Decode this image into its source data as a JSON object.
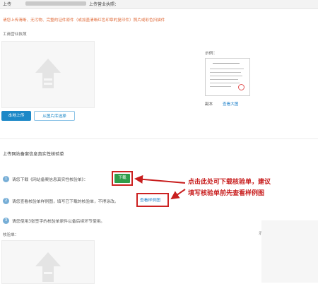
{
  "header": {
    "label_left": "上传",
    "label_right": "上传营业执照："
  },
  "requirements": "请您上传清晰、无污物、完整的证件原件（或加盖清晰红色印章的复印件）照片或彩色扫描件",
  "business_license": {
    "label": "工商营业执照",
    "sample_label": "示例：",
    "copy_label": "副本",
    "view_large": "查看大图",
    "local_upload_button": "本地上传",
    "library_button": "从图片库选择"
  },
  "verification": {
    "section_title": "上传网站备案信息真实性核验单",
    "steps": [
      {
        "num": "1",
        "text": "请您下载《网站备案信息真实性核验单》："
      },
      {
        "num": "2",
        "text": "请您查看核验单样例图，填写已下载的核验单，不得涂改。"
      },
      {
        "num": "3",
        "text": "请您使用3张签字的核验单原件以备后续环节使用。"
      }
    ],
    "download_button": "下载",
    "view_sample_link": "查看样例图",
    "bottom_label": "核验单：",
    "right_fragment": "示"
  },
  "annotation": {
    "line1": "点击此处可下载核验单，建议",
    "line2": "填写核验单前先查看样例图",
    "color": "#c81e1e"
  },
  "colors": {
    "primary_blue": "#1c88c7",
    "download_green": "#2f9d4a",
    "highlight_red": "#cc2222",
    "warning_orange": "#e06b3a"
  }
}
